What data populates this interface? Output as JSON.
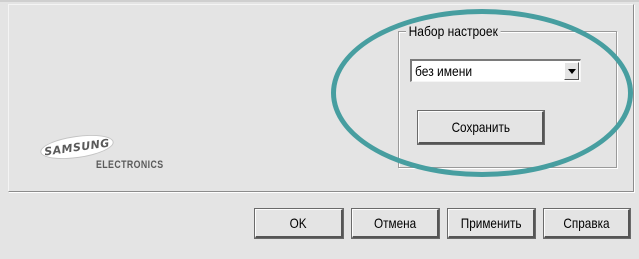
{
  "preset_group": {
    "legend": "Набор настроек",
    "preset_select": {
      "selected_value": "без имени"
    },
    "save_button_label": "Сохранить"
  },
  "branding": {
    "logo_text_primary": "SAMSUNG",
    "logo_text_secondary": "ELECTRONICS"
  },
  "dialog_buttons": {
    "ok_label": "OK",
    "cancel_label": "Отмена",
    "apply_label": "Применить",
    "help_label": "Справка"
  },
  "annotation": {
    "highlight_color": "#479ea0"
  }
}
